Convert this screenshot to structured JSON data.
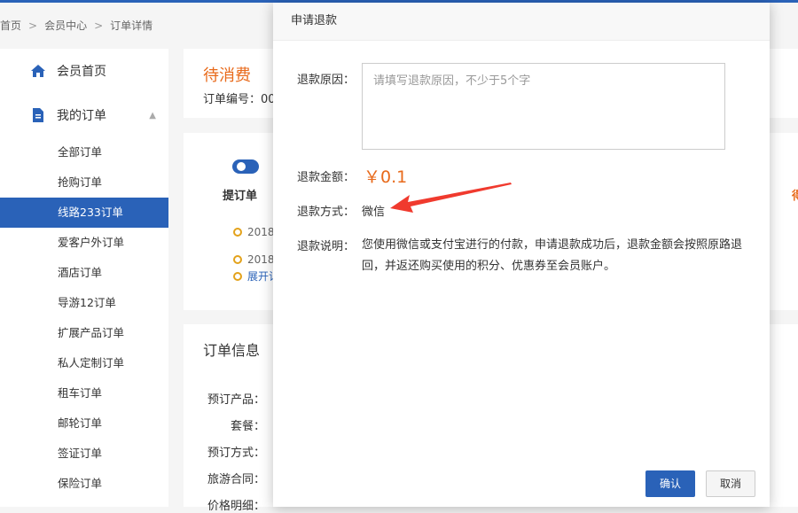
{
  "breadcrumb": {
    "home": "首页",
    "sep": ">",
    "member": "会员中心",
    "current": "订单详情"
  },
  "sidebar": {
    "home": "会员首页",
    "orders": "我的订单",
    "items": [
      "全部订单",
      "抢购订单",
      "线路233订单",
      "爱客户外订单",
      "酒店订单",
      "导游12订单",
      "扩展产品订单",
      "私人定制订单",
      "租车订单",
      "邮轮订单",
      "签证订单",
      "保险订单"
    ]
  },
  "order": {
    "status": "待消费",
    "order_no_label": "订单编号：00",
    "step": "提订单",
    "right_step": "得",
    "log_date": "2018",
    "expand_label": "展开记"
  },
  "info": {
    "title": "订单信息",
    "rows": [
      "预订产品：",
      "套餐：",
      "预订方式：",
      "旅游合同：",
      "价格明细："
    ]
  },
  "modal": {
    "title": "申请退款",
    "reason_label": "退款原因：",
    "reason_placeholder": "请填写退款原因，不少于5个字",
    "amount_label": "退款金额：",
    "amount": "￥0.1",
    "method_label": "退款方式：",
    "method": "微信",
    "note_label": "退款说明：",
    "note": "您使用微信或支付宝进行的付款，申请退款成功后，退款金额会按照原路退回，并返还购买使用的积分、优惠券至会员账户。",
    "confirm": "确认",
    "cancel": "取消"
  },
  "colors": {
    "accent": "#2a62b8",
    "orange": "#e86a1b",
    "arrow": "#f03a2e"
  }
}
